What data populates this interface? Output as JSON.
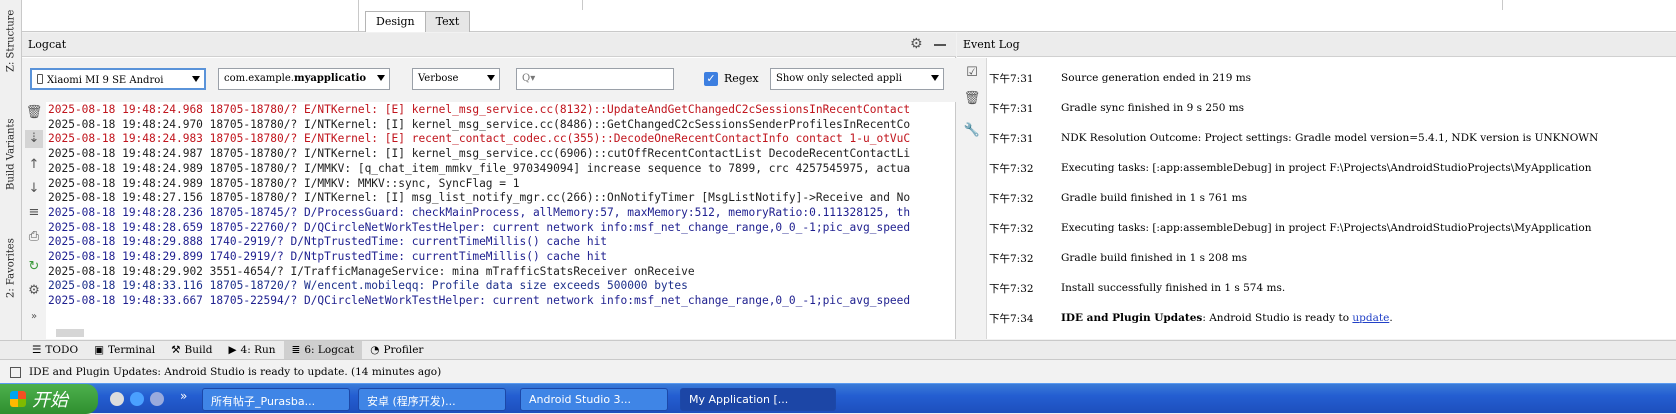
{
  "sidebar": {
    "tabs": [
      "Z: Structure",
      "Build Variants",
      "2: Favorites"
    ]
  },
  "design_tabs": [
    "Design",
    "Text"
  ],
  "logcat": {
    "title": "Logcat",
    "device": "Xiaomi MI 9 SE Androi",
    "process_prefix": "com.example.",
    "process_bold": "myapplicatio",
    "level": "Verbose",
    "search_placeholder": "Q▾",
    "regex_label": "Regex",
    "regex_checked": true,
    "filter": "Show only selected appli",
    "lines": [
      {
        "level": "E",
        "text": "2025-08-18 19:48:24.968 18705-18780/? E/NTKernel: [E] kernel_msg_service.cc(8132)::UpdateAndGetChangedC2cSessionsInRecentContact"
      },
      {
        "level": "I",
        "text": "2025-08-18 19:48:24.970 18705-18780/? I/NTKernel: [I] kernel_msg_service.cc(8486)::GetChangedC2cSessionsSenderProfilesInRecentCo"
      },
      {
        "level": "E",
        "text": "2025-08-18 19:48:24.983 18705-18780/? E/NTKernel: [E] recent_contact_codec.cc(355)::DecodeOneRecentContactInfo contact 1-u_otVuC"
      },
      {
        "level": "I",
        "text": "2025-08-18 19:48:24.987 18705-18780/? I/NTKernel: [I] kernel_msg_service.cc(6906)::cutOffRecentContactList DecodeRecentContactLi"
      },
      {
        "level": "I",
        "text": "2025-08-18 19:48:24.989 18705-18780/? I/MMKV: [q_chat_item_mmkv_file_970349094] increase sequence to 7899, crc 4257545975, actua"
      },
      {
        "level": "I",
        "text": "2025-08-18 19:48:24.989 18705-18780/? I/MMKV: MMKV::sync, SyncFlag = 1"
      },
      {
        "level": "I",
        "text": "2025-08-18 19:48:27.156 18705-18780/? I/NTKernel: [I] msg_list_notify_mgr.cc(266)::OnNotifyTimer [MsgListNotify]->Receive and No"
      },
      {
        "level": "D",
        "text": "2025-08-18 19:48:28.236 18705-18745/? D/ProcessGuard: checkMainProcess, allMemory:57, maxMemory:512, memoryRatio:0.111328125, th"
      },
      {
        "level": "D",
        "text": "2025-08-18 19:48:28.659 18705-22760/? D/QCircleNetWorkTestHelper: current network info:msf_net_change_range,0_0_-1;pic_avg_speed"
      },
      {
        "level": "D",
        "text": "2025-08-18 19:48:29.888 1740-2919/? D/NtpTrustedTime: currentTimeMillis() cache hit"
      },
      {
        "level": "D",
        "text": "2025-08-18 19:48:29.899 1740-2919/? D/NtpTrustedTime: currentTimeMillis() cache hit"
      },
      {
        "level": "I",
        "text": "2025-08-18 19:48:29.902 3551-4654/? I/TrafficManageService: mina mTrafficStatsReceiver onReceive"
      },
      {
        "level": "W",
        "text": "2025-08-18 19:48:33.116 18705-18720/? W/encent.mobileqq: Profile data size exceeds 500000 bytes"
      },
      {
        "level": "D",
        "text": "2025-08-18 19:48:33.667 18705-22594/? D/QCircleNetWorkTestHelper: current network info:msf_net_change_range,0_0_-1;pic_avg_speed"
      }
    ]
  },
  "event_log": {
    "title": "Event Log",
    "events": [
      {
        "time": "下午7:31",
        "bold": "",
        "text": "Source generation ended in 219 ms",
        "link": ""
      },
      {
        "time": "下午7:31",
        "bold": "",
        "text": "Gradle sync finished in 9 s 250 ms",
        "link": ""
      },
      {
        "time": "下午7:31",
        "bold": "",
        "text": "NDK Resolution Outcome: Project settings: Gradle model version=5.4.1, NDK version is UNKNOWN",
        "link": ""
      },
      {
        "time": "下午7:32",
        "bold": "",
        "text": "Executing tasks: [:app:assembleDebug] in project F:\\Projects\\AndroidStudioProjects\\MyApplication",
        "link": ""
      },
      {
        "time": "下午7:32",
        "bold": "",
        "text": "Gradle build finished in 1 s 761 ms",
        "link": ""
      },
      {
        "time": "下午7:32",
        "bold": "",
        "text": "Executing tasks: [:app:assembleDebug] in project F:\\Projects\\AndroidStudioProjects\\MyApplication",
        "link": ""
      },
      {
        "time": "下午7:32",
        "bold": "",
        "text": "Gradle build finished in 1 s 208 ms",
        "link": ""
      },
      {
        "time": "下午7:32",
        "bold": "",
        "text": "Install successfully finished in 1 s 574 ms.",
        "link": ""
      },
      {
        "time": "下午7:34",
        "bold": "IDE and Plugin Updates",
        "text": ": Android Studio is ready to ",
        "link": "update"
      }
    ]
  },
  "bottom_tabs": [
    {
      "label": "TODO",
      "icon": "list-icon"
    },
    {
      "label": "Terminal",
      "icon": "terminal-icon"
    },
    {
      "label": "Build",
      "icon": "hammer-icon"
    },
    {
      "label": "4: Run",
      "icon": "run-icon"
    },
    {
      "label": "6: Logcat",
      "icon": "logcat-icon"
    },
    {
      "label": "Profiler",
      "icon": "profiler-icon"
    }
  ],
  "statusbar": {
    "text": "IDE and Plugin Updates: Android Studio is ready to update. (14 minutes ago)"
  },
  "taskbar": {
    "start_label": "开始",
    "items": [
      "所有帖子_Purasba...",
      "安卓 (程序开发)...",
      "Android Studio 3...",
      "My Application [..."
    ]
  }
}
